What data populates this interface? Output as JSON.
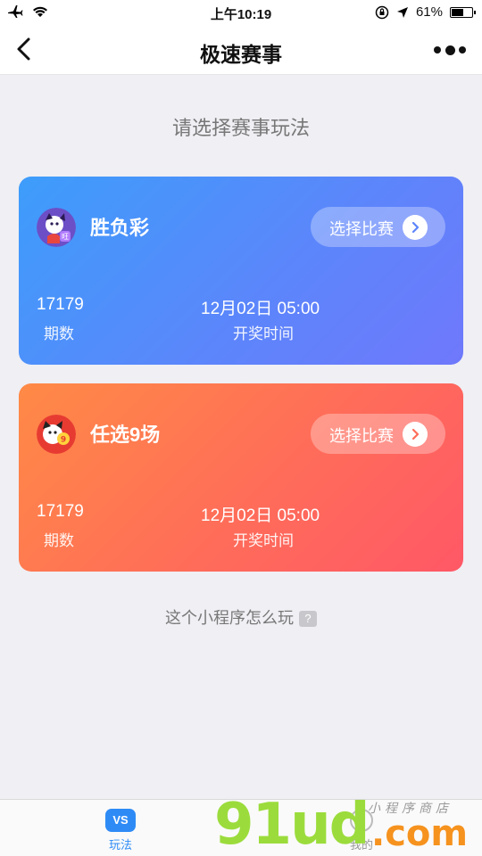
{
  "status_bar": {
    "time": "上午10:19",
    "battery": "61%",
    "battery_level": 0.61
  },
  "nav": {
    "title": "极速赛事"
  },
  "subtitle": "请选择赛事玩法",
  "games": [
    {
      "name": "胜负彩",
      "button_label": "选择比赛",
      "issue_number": "17179",
      "issue_label": "期数",
      "draw_time": "12月02日 05:00",
      "draw_label": "开奖时间",
      "accent_from": "#3d9dfb",
      "accent_to": "#6f78fb",
      "logo_badge": "旺"
    },
    {
      "name": "任选9场",
      "button_label": "选择比赛",
      "issue_number": "17179",
      "issue_label": "期数",
      "draw_time": "12月02日 05:00",
      "draw_label": "开奖时间",
      "accent_from": "#ff8a46",
      "accent_to": "#ff5866",
      "logo_badge": "9"
    }
  ],
  "howto": {
    "label": "这个小程序怎么玩",
    "icon": "?"
  },
  "tabbar": {
    "tabs": [
      {
        "label": "玩法",
        "icon": "VS",
        "active": true
      },
      {
        "label": "我的",
        "icon": "user-icon",
        "active": false
      }
    ]
  },
  "watermark": {
    "brand": "91ud",
    "domain": ".com",
    "tagline": "小程序商店"
  }
}
